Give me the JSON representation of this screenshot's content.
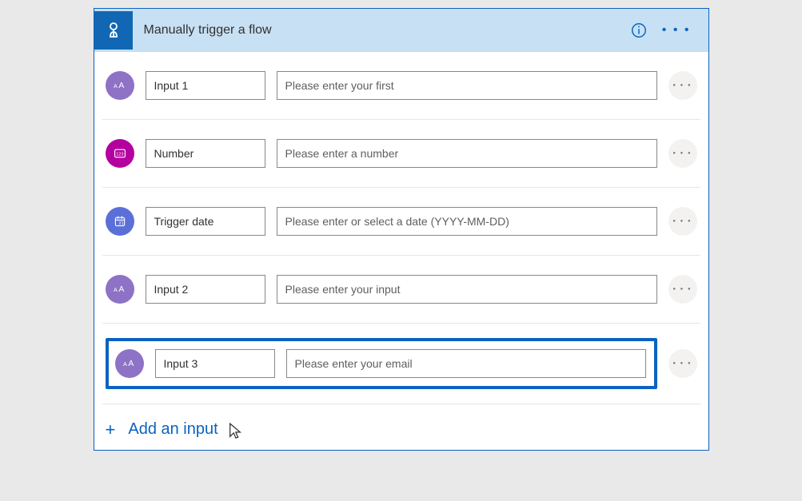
{
  "header": {
    "title": "Manually trigger a flow"
  },
  "inputs": [
    {
      "icon": "text",
      "name": "Input 1",
      "placeholder": "Please enter your first"
    },
    {
      "icon": "number",
      "name": "Number",
      "placeholder": "Please enter a number"
    },
    {
      "icon": "date",
      "name": "Trigger date",
      "placeholder": "Please enter or select a date (YYYY-MM-DD)"
    },
    {
      "icon": "text",
      "name": "Input 2",
      "placeholder": "Please enter your input"
    },
    {
      "icon": "text",
      "name": "Input 3",
      "placeholder": "Please enter your email",
      "highlighted": true
    }
  ],
  "addInput": {
    "label": "Add an input"
  }
}
